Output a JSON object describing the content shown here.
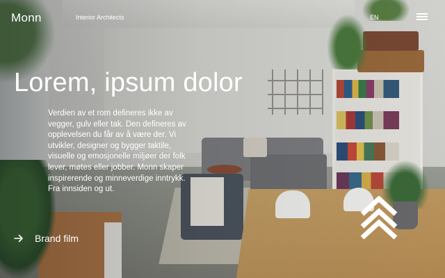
{
  "header": {
    "logo": "Monn",
    "tagline": "Interior Architects",
    "language": "EN",
    "menu_icon": "hamburger-menu-icon"
  },
  "hero": {
    "title": "Lorem, ipsum dolor",
    "body": "Verdien av et rom defineres ikke av vegger, gulv eller tak. Den defineres av opplevelsen du får av å være der. Vi utvikler, designer og bygger taktile, visuelle og emosjonelle miljøer der folk lever, møtes eller jobber. Monn skaper inspirerende og minneverdige inntrykk. Fra innsiden og ut."
  },
  "cta": {
    "label": "Brand film",
    "icon": "arrow-right-icon"
  },
  "scroll": {
    "icon": "double-chevron-up-icon"
  },
  "colors": {
    "text": "#ffffff"
  }
}
